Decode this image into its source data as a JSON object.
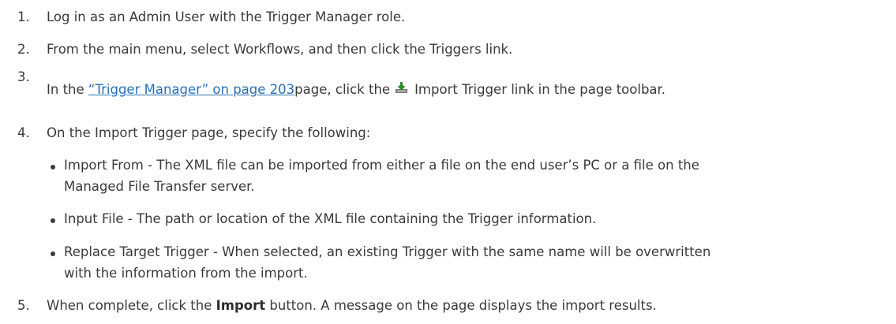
{
  "steps": [
    {
      "num": "1.",
      "text": "Log in as an Admin User with the Trigger Manager role."
    },
    {
      "num": "2.",
      "text": "From the main menu, select Workflows, and then click the Triggers link."
    },
    {
      "num": "3.",
      "pre": "In the ",
      "link": "“Trigger Manager” on page 203",
      "mid": "page, click the",
      "icon": "import-download-icon",
      "post": "Import Trigger link in the page toolbar."
    },
    {
      "num": "4.",
      "text": "On the Import Trigger page, specify the following:"
    },
    {
      "num": "5.",
      "pre": "When complete, click the ",
      "bold": "Import",
      "post": " button. A message on the page displays the import results."
    }
  ],
  "bullets": [
    {
      "line1": "Import From - The XML file can be imported from either a file on the end user’s PC or a file on the",
      "line2": "Managed File Transfer server."
    },
    {
      "line1": "Input File - The path or location of the XML file containing the Trigger information."
    },
    {
      "line1": "Replace Target Trigger - When selected, an existing Trigger with the same name will be overwritten",
      "line2": "with the information from the import."
    }
  ],
  "colors": {
    "text": "#3a3a3a",
    "link": "#2a6fb3",
    "icon_green": "#2e8b2e"
  }
}
